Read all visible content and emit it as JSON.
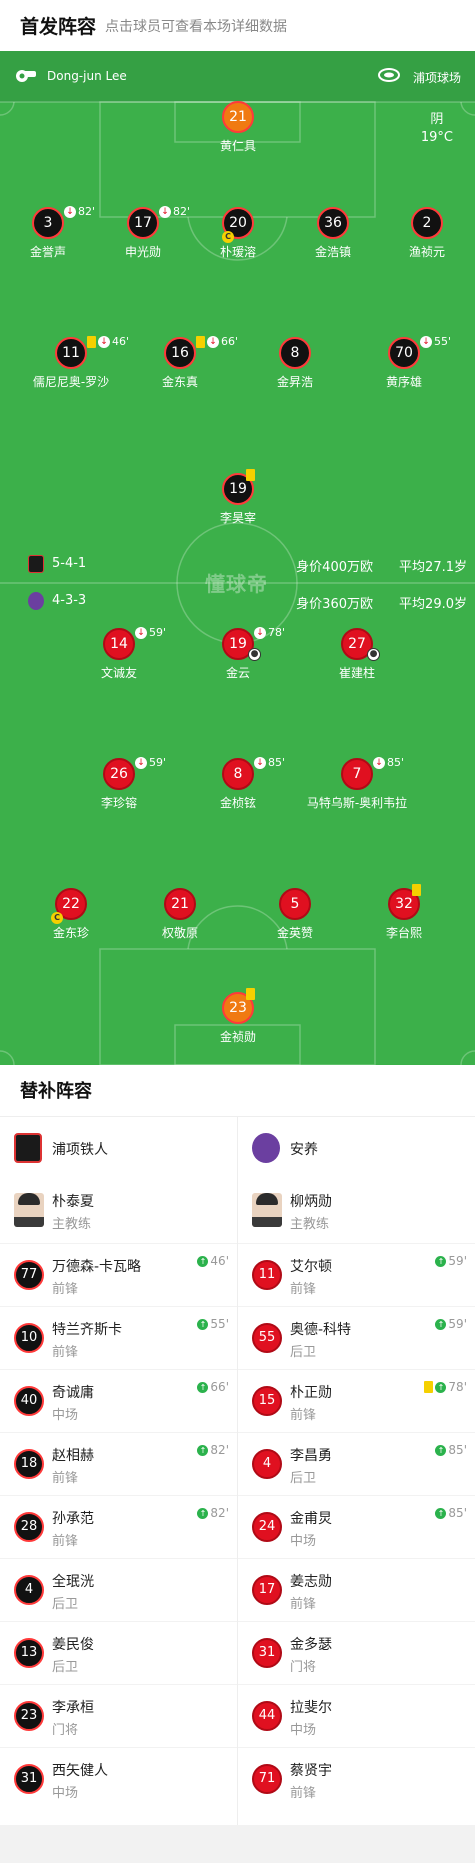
{
  "header": {
    "title": "首发阵容",
    "subtitle": "点击球员可查看本场详细数据"
  },
  "pitch": {
    "referee": "Dong-jun Lee",
    "venue": "浦项球场",
    "weather": "阴",
    "temperature": "19°C",
    "watermark": "懂球帝",
    "home_formation": {
      "formation": "5-4-1"
    },
    "away_formation": {
      "formation": "4-3-3",
      "value": "身价360万欧",
      "avg_age": "平均29.0岁"
    },
    "home_stats": {
      "value": "身价400万欧",
      "avg_age": "平均27.1岁"
    }
  },
  "home_players": [
    {
      "no": "21",
      "name": "黄仁具",
      "gk": true
    },
    {
      "no": "3",
      "name": "金誉声",
      "sub": "82'"
    },
    {
      "no": "17",
      "name": "申光勋",
      "sub": "82'"
    },
    {
      "no": "20",
      "name": "朴瑷溶",
      "captain": true
    },
    {
      "no": "36",
      "name": "金浩镇"
    },
    {
      "no": "2",
      "name": "渔祯元"
    },
    {
      "no": "11",
      "name": "儒尼尼奥-罗沙",
      "yellow": true,
      "sub": "46'"
    },
    {
      "no": "16",
      "name": "金东真",
      "yellow": true,
      "sub": "66'"
    },
    {
      "no": "8",
      "name": "金昇浩"
    },
    {
      "no": "70",
      "name": "黄序雄",
      "sub": "55'"
    },
    {
      "no": "19",
      "name": "李昊宰",
      "yellow": true
    }
  ],
  "away_players": [
    {
      "no": "14",
      "name": "文诚友",
      "sub": "59'"
    },
    {
      "no": "19",
      "name": "金云",
      "sub": "78'",
      "goal": true
    },
    {
      "no": "27",
      "name": "崔建柱",
      "goal": true
    },
    {
      "no": "26",
      "name": "李珍镕",
      "sub": "59'"
    },
    {
      "no": "8",
      "name": "金桢铉",
      "sub": "85'"
    },
    {
      "no": "7",
      "name": "马特乌斯-奥利韦拉",
      "sub": "85'"
    },
    {
      "no": "22",
      "name": "金东珍",
      "captain": true
    },
    {
      "no": "21",
      "name": "权敬原"
    },
    {
      "no": "5",
      "name": "金英赞"
    },
    {
      "no": "32",
      "name": "李台熙",
      "yellow": true
    },
    {
      "no": "23",
      "name": "金祯勋",
      "gk": true,
      "yellow": true
    }
  ],
  "subs": {
    "title": "替补阵容",
    "home": {
      "team": "浦项铁人",
      "coach": {
        "name": "朴泰夏",
        "role": "主教练"
      },
      "players": [
        {
          "no": "77",
          "name": "万德森-卡瓦略",
          "pos": "前锋",
          "in": "46'"
        },
        {
          "no": "10",
          "name": "特兰齐斯卡",
          "pos": "前锋",
          "in": "55'"
        },
        {
          "no": "40",
          "name": "奇诚庸",
          "pos": "中场",
          "in": "66'"
        },
        {
          "no": "18",
          "name": "赵相赫",
          "pos": "前锋",
          "in": "82'"
        },
        {
          "no": "28",
          "name": "孙承范",
          "pos": "前锋",
          "in": "82'"
        },
        {
          "no": "4",
          "name": "全珉洸",
          "pos": "后卫"
        },
        {
          "no": "13",
          "name": "姜民俊",
          "pos": "后卫"
        },
        {
          "no": "23",
          "name": "李承桓",
          "pos": "门将"
        },
        {
          "no": "31",
          "name": "西矢健人",
          "pos": "中场"
        }
      ]
    },
    "away": {
      "team": "安养",
      "coach": {
        "name": "柳炳勋",
        "role": "主教练"
      },
      "players": [
        {
          "no": "11",
          "name": "艾尔顿",
          "pos": "前锋",
          "in": "59'"
        },
        {
          "no": "55",
          "name": "奥德-科特",
          "pos": "后卫",
          "in": "59'"
        },
        {
          "no": "15",
          "name": "朴正勋",
          "pos": "前锋",
          "in": "78'",
          "yellow": true
        },
        {
          "no": "4",
          "name": "李昌勇",
          "pos": "后卫",
          "in": "85'"
        },
        {
          "no": "24",
          "name": "金甫炅",
          "pos": "中场",
          "in": "85'"
        },
        {
          "no": "17",
          "name": "姜志勋",
          "pos": "前锋"
        },
        {
          "no": "31",
          "name": "金多瑟",
          "pos": "门将"
        },
        {
          "no": "44",
          "name": "拉斐尔",
          "pos": "中场"
        },
        {
          "no": "71",
          "name": "蔡贤宇",
          "pos": "前锋"
        }
      ]
    }
  },
  "colors": {
    "pitch": "#3cb04a",
    "home_shirt": "#111111",
    "away_shirt": "#e01020",
    "gk_home": "#f07a12",
    "gk_away": "#f07a12",
    "card_yellow": "#f5d000"
  }
}
